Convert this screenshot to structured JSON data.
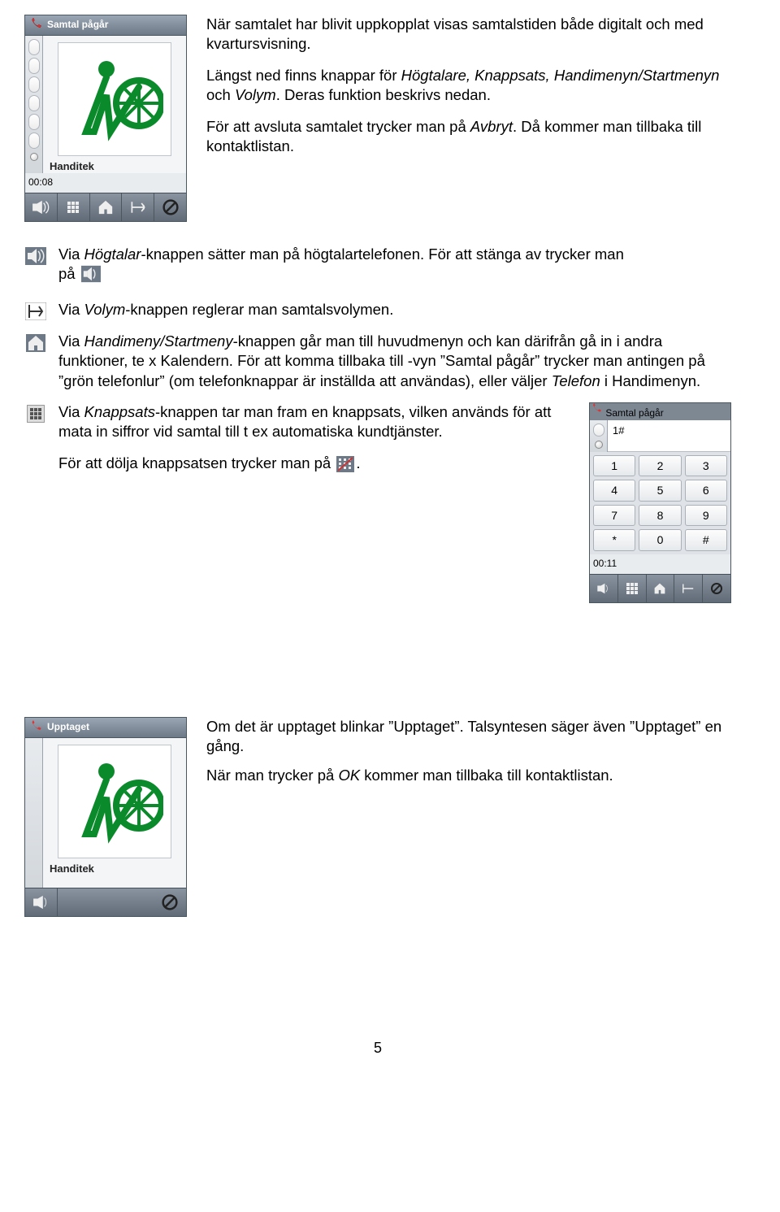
{
  "phone1": {
    "title": "Samtal pågår",
    "caption": "Handitek",
    "timer": "00:08"
  },
  "toolbar_icons": {
    "speaker": "speaker-icon",
    "keypad": "keypad-icon",
    "home": "home-icon",
    "volume": "volume-icon",
    "cancel": "cancel-icon"
  },
  "intro": {
    "p1": "När samtalet har blivit uppkopplat visas samtalstiden både digitalt och med kvartursvisning.",
    "p2a": "Längst ned finns knappar för ",
    "p2_italics": "Högtalare, Knappsats, Handimenyn/Startmenyn",
    "p2b": " och ",
    "p2_vol": "Volym",
    "p2c": ". Deras funktion beskrivs nedan.",
    "p3a": "För att avsluta samtalet trycker man på ",
    "p3_italic": "Avbryt",
    "p3b": ". Då kommer man tillbaka till kontaktlistan."
  },
  "bullets": {
    "b1a": "Via ",
    "b1_i": "Högtalar",
    "b1b": "-knappen sätter man på högtalartelefonen. För att stänga av trycker man",
    "b1c": "på ",
    "b2a": "Via ",
    "b2_i": "Volym",
    "b2b": "-knappen reglerar man samtalsvolymen.",
    "b3a": "Via ",
    "b3_i": "Handimeny/Startmeny",
    "b3b": "-knappen går man till huvudmenyn och kan därifrån gå in i andra funktioner, te x Kalendern. För att komma tillbaka till -vyn ”Samtal pågår” trycker man antingen på ”grön telefonlur” (om telefonknappar är inställda att användas), eller väljer ",
    "b3_i2": "Telefon",
    "b3c": " i Handimenyn.",
    "b4a": "Via ",
    "b4_i": "Knappsats",
    "b4b": "-knappen tar man fram en knappsats, vilken används för att mata in siffror vid samtal till t ex automatiska kundtjänster.",
    "b4c": "För att dölja knappsatsen trycker man på ",
    "b4d": "."
  },
  "mini": {
    "title": "Samtal pågår",
    "display": "1#",
    "keys": [
      "1",
      "2",
      "3",
      "4",
      "5",
      "6",
      "7",
      "8",
      "9",
      "*",
      "0",
      "#"
    ],
    "timer": "00:11"
  },
  "phone2": {
    "title": "Upptaget",
    "caption": "Handitek"
  },
  "busy": {
    "p1": "Om det är upptaget blinkar ”Upptaget”. Talsyntesen säger även ”Upptaget” en gång.",
    "p2a": "När man trycker på ",
    "p2_i": "OK",
    "p2b": " kommer man tillbaka till kontaktlistan."
  },
  "pagenum": "5"
}
